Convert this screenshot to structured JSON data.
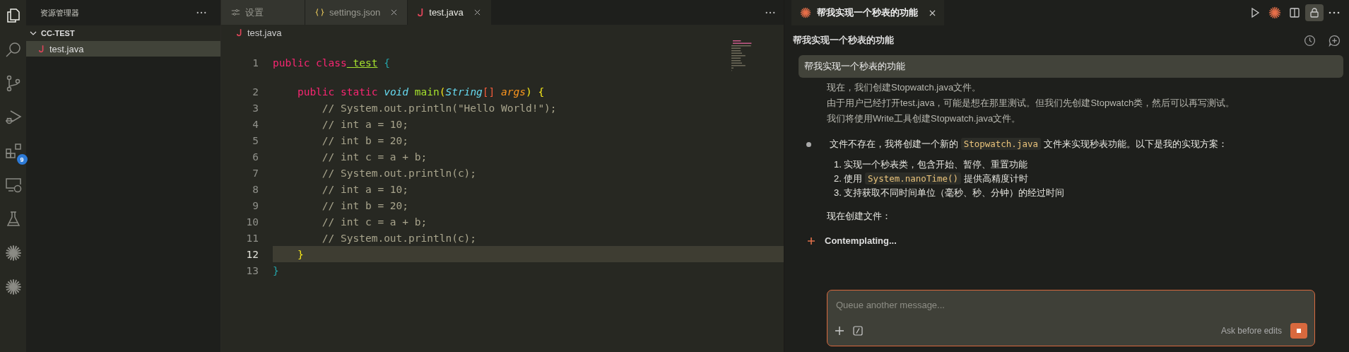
{
  "activity_bar": {
    "items": [
      {
        "kind": "files",
        "selected": true
      },
      {
        "kind": "search",
        "selected": false
      },
      {
        "kind": "git",
        "selected": false
      },
      {
        "kind": "debug",
        "selected": false
      },
      {
        "kind": "extensions",
        "selected": false,
        "badge": "9"
      },
      {
        "kind": "remote",
        "selected": false
      },
      {
        "kind": "flask",
        "selected": false
      },
      {
        "kind": "spark",
        "selected": false
      },
      {
        "kind": "spark",
        "selected": false
      }
    ]
  },
  "sidebar": {
    "title": "资源管理器",
    "folder": {
      "name": "CC-TEST",
      "expanded": true,
      "children": [
        {
          "name": "test.java",
          "selected": true
        }
      ]
    }
  },
  "editor": {
    "tabs": [
      {
        "label": "设置",
        "kind": "settings",
        "selected": false,
        "closable": false
      },
      {
        "label": "settings.json",
        "kind": "json",
        "selected": false,
        "closable": true
      },
      {
        "label": "test.java",
        "kind": "java",
        "selected": true,
        "closable": true
      }
    ],
    "breadcrumb": "test.java",
    "lines": [
      {
        "number": "1",
        "current": false,
        "tokens": [
          {
            "t": "public",
            "kind": "keyword"
          },
          {
            "t": " class",
            "kind": "keyword"
          },
          {
            "t": " test",
            "kind": "classname"
          },
          {
            "t": " {",
            "kind": "brace"
          }
        ]
      },
      {
        "number": "2",
        "current": false,
        "tokens": [
          {
            "t": "    public",
            "kind": "keyword"
          },
          {
            "t": " static",
            "kind": "keyword"
          },
          {
            "t": " void",
            "kind": "type"
          },
          {
            "t": " main",
            "kind": "function"
          },
          {
            "t": "(",
            "kind": "paren"
          },
          {
            "t": "String",
            "kind": "type"
          },
          {
            "t": "[]",
            "kind": "operator"
          },
          {
            "t": " args",
            "kind": "param"
          },
          {
            "t": ")",
            "kind": "paren"
          },
          {
            "t": " {",
            "kind": "paren"
          }
        ]
      },
      {
        "number": "3",
        "current": false,
        "tokens": [
          {
            "t": "        // System.out.println(\"Hello World!\");",
            "kind": "comment"
          }
        ]
      },
      {
        "number": "4",
        "current": false,
        "tokens": [
          {
            "t": "        // int a = 10;",
            "kind": "comment"
          }
        ]
      },
      {
        "number": "5",
        "current": false,
        "tokens": [
          {
            "t": "        // int b = 20;",
            "kind": "comment"
          }
        ]
      },
      {
        "number": "6",
        "current": false,
        "tokens": [
          {
            "t": "        // int c = a + b;",
            "kind": "comment"
          }
        ]
      },
      {
        "number": "7",
        "current": false,
        "tokens": [
          {
            "t": "        // System.out.println(c);",
            "kind": "comment"
          }
        ]
      },
      {
        "number": "8",
        "current": false,
        "tokens": [
          {
            "t": "        // int a = 10;",
            "kind": "comment"
          }
        ]
      },
      {
        "number": "9",
        "current": false,
        "tokens": [
          {
            "t": "        // int b = 20;",
            "kind": "comment"
          }
        ]
      },
      {
        "number": "10",
        "current": false,
        "tokens": [
          {
            "t": "        // int c = a + b;",
            "kind": "comment"
          }
        ]
      },
      {
        "number": "11",
        "current": false,
        "tokens": [
          {
            "t": "        // System.out.println(c);",
            "kind": "comment"
          }
        ]
      },
      {
        "number": "12",
        "current": true,
        "tokens": [
          {
            "t": "    }",
            "kind": "paren"
          }
        ]
      },
      {
        "number": "13",
        "current": false,
        "tokens": [
          {
            "t": "}",
            "kind": "brace"
          }
        ]
      }
    ]
  },
  "chat": {
    "tab": {
      "label": "帮我实现一个秒表的功能",
      "closable": true
    },
    "toolbar": [
      {
        "kind": "run",
        "selected": false
      },
      {
        "kind": "spark",
        "selected": false
      },
      {
        "kind": "split",
        "selected": false
      },
      {
        "kind": "lock",
        "selected": true
      },
      {
        "kind": "more",
        "selected": false
      }
    ],
    "title": "帮我实现一个秒表的功能",
    "user_message": "帮我实现一个秒表的功能",
    "thinking": [
      "现在，我们创建Stopwatch.java文件。",
      "由于用户已经打开test.java，可能是想在那里测试。但我们先创建Stopwatch类，然后可以再写测试。",
      "我们将使用Write工具创建Stopwatch.java文件。"
    ],
    "bullet": [
      {
        "t": "文件不存在，我将创建一个新的 "
      },
      {
        "t": "Stopwatch.java",
        "code": true
      },
      {
        "t": " 文件来实现秒表功能。以下是我的实现方案："
      }
    ],
    "steps": [
      {
        "number": "1.",
        "parts": [
          {
            "t": "实现一个秒表类，包含开始、暂停、重置功能"
          }
        ]
      },
      {
        "number": "2.",
        "parts": [
          {
            "t": "使用 "
          },
          {
            "t": "System.nanoTime()",
            "code": true
          },
          {
            "t": " 提供高精度计时"
          }
        ]
      },
      {
        "number": "3.",
        "parts": [
          {
            "t": "支持获取不同时间单位（毫秒、秒、分钟）的经过时间"
          }
        ]
      }
    ],
    "after": "现在创建文件：",
    "status": "Contemplating...",
    "input": {
      "placeholder": "Queue another message...",
      "mode": "Ask before edits"
    }
  }
}
